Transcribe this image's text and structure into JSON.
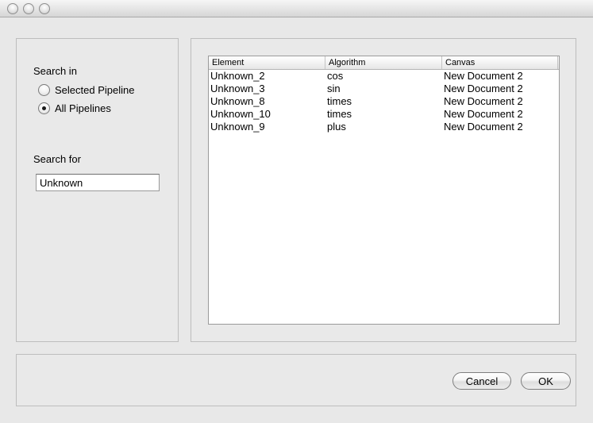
{
  "search": {
    "search_in_label": "Search in",
    "options": [
      {
        "label": "Selected Pipeline",
        "selected": false
      },
      {
        "label": "All Pipelines",
        "selected": true
      }
    ],
    "search_for_label": "Search for",
    "query": "Unknown"
  },
  "results": {
    "columns": [
      "Element",
      "Algorithm",
      "Canvas"
    ],
    "rows": [
      [
        "Unknown_2",
        "cos",
        "New Document 2"
      ],
      [
        "Unknown_3",
        "sin",
        "New Document 2"
      ],
      [
        "Unknown_8",
        "times",
        "New Document 2"
      ],
      [
        "Unknown_10",
        "times",
        "New Document 2"
      ],
      [
        "Unknown_9",
        "plus",
        "New Document 2"
      ]
    ]
  },
  "buttons": {
    "cancel": "Cancel",
    "ok": "OK"
  }
}
